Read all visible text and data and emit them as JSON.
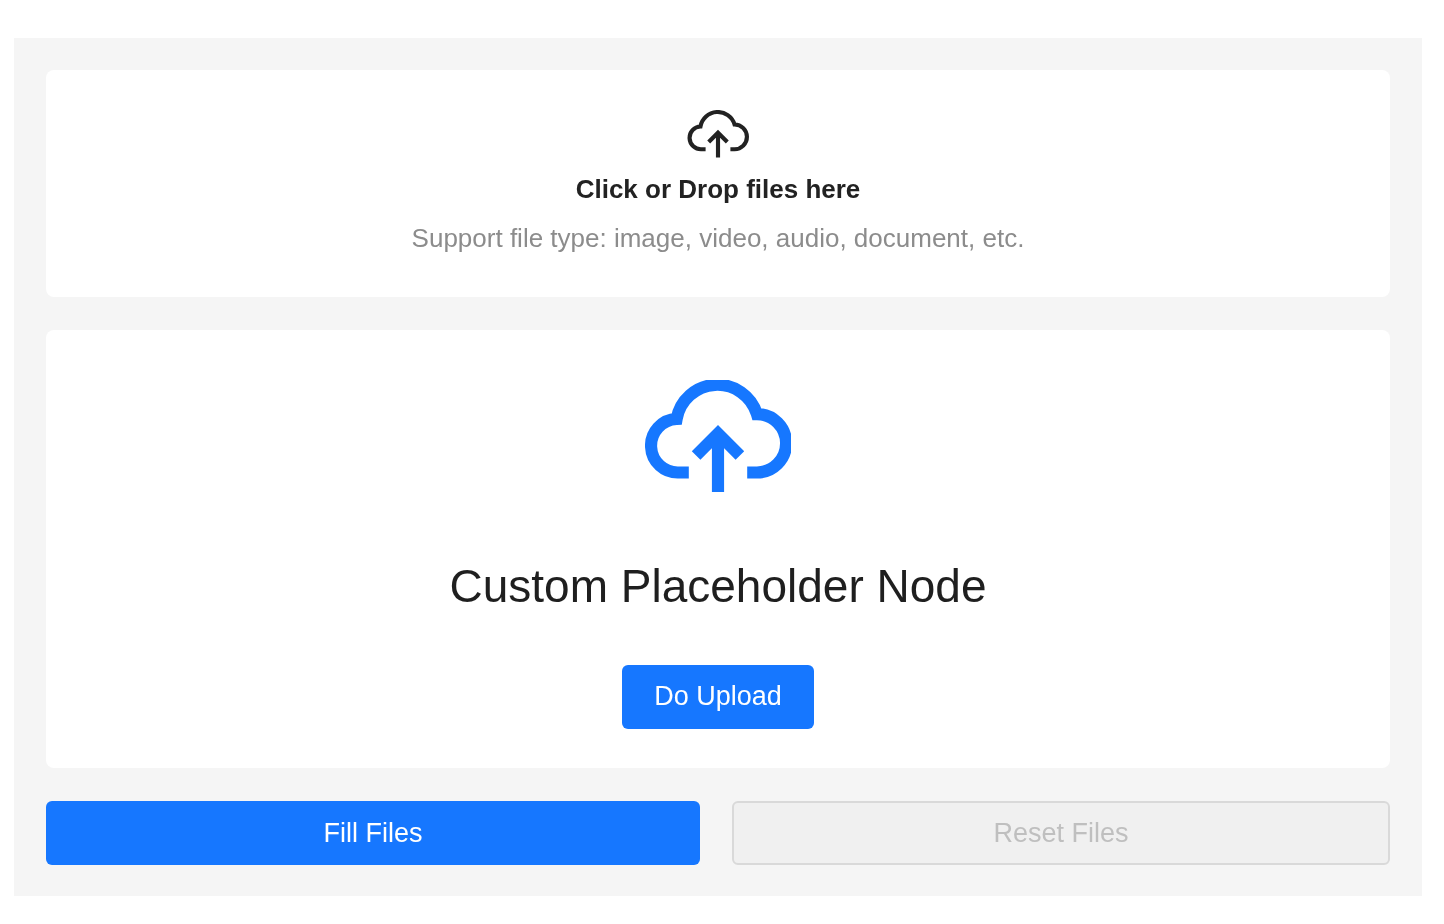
{
  "dropzone": {
    "title": "Click or Drop files here",
    "hint": "Support file type: image, video, audio, document, etc."
  },
  "custom_placeholder": {
    "title": "Custom Placeholder Node",
    "button": "Do Upload"
  },
  "buttons": [
    {
      "label": "Fill Files",
      "kind": "primary",
      "disabled": false
    },
    {
      "label": "Reset Files",
      "kind": "default",
      "disabled": true
    }
  ]
}
